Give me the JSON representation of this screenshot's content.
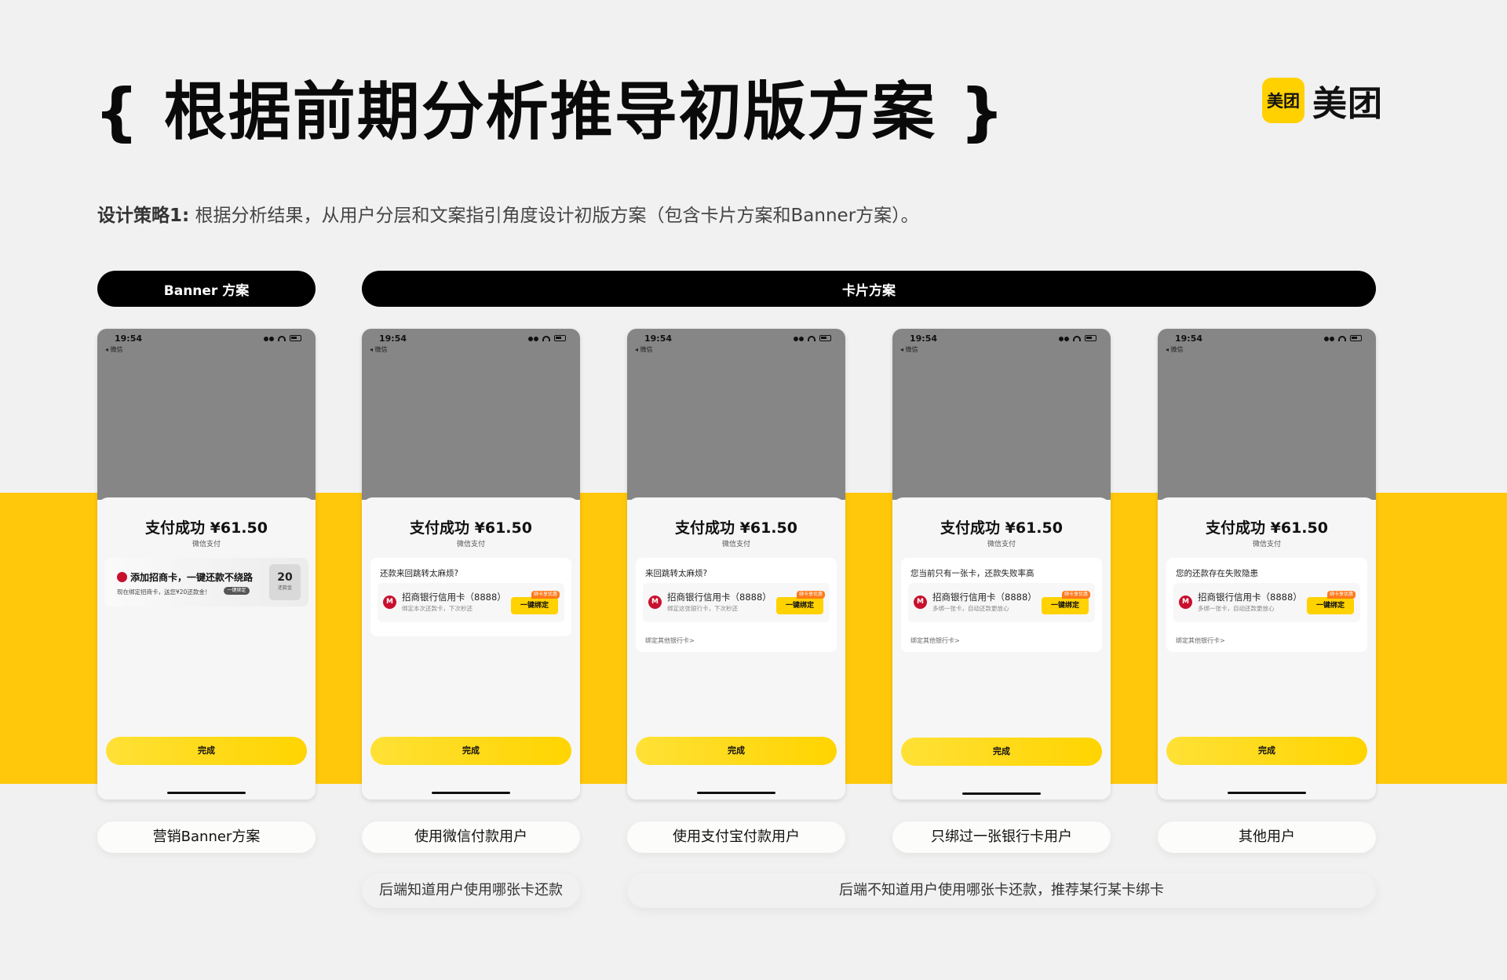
{
  "title": "{ 根据前期分析推导初版方案 }",
  "logo": {
    "badge": "美团",
    "text": "美团",
    "brand_color": "#ffd100"
  },
  "strategy": {
    "label": "设计策略1:",
    "text": " 根据分析结果，从用户分层和文案指引角度设计初版方案（包含卡片方案和Banner方案）。"
  },
  "section_pills": {
    "banner": "Banner 方案",
    "card": "卡片方案"
  },
  "accent_band_color": "#ffc80a",
  "phones": [
    {
      "status_time": "19:54",
      "back_label": "◂ 微信",
      "pay_title": "支付成功 ¥61.50",
      "pay_method": "微信支付",
      "banner": {
        "title": "添加招商卡，一键还款不绕路",
        "sub": "现在绑定招商卡，送您¥20还款金！",
        "chip": "一键绑定",
        "coupon_num": "20",
        "coupon_sub": "还款金"
      },
      "done_label": "完成",
      "user_label": "营销Banner方案"
    },
    {
      "status_time": "19:54",
      "back_label": "◂ 微信",
      "pay_title": "支付成功 ¥61.50",
      "pay_method": "微信支付",
      "card": {
        "question": "还款来回跳转太麻烦?",
        "bank_name": "招商银行信用卡（8888）",
        "bank_desc": "绑定本次还款卡，下次秒还",
        "bind_label": "一键绑定",
        "bind_tag": "绑卡享优惠",
        "other_bank": ""
      },
      "done_label": "完成",
      "user_label": "使用微信付款用户"
    },
    {
      "status_time": "19:54",
      "back_label": "◂ 微信",
      "pay_title": "支付成功 ¥61.50",
      "pay_method": "微信支付",
      "card": {
        "question": "来回跳转太麻烦?",
        "bank_name": "招商银行信用卡（8888）",
        "bank_desc": "绑定这张银行卡，下次秒还",
        "bind_label": "一键绑定",
        "bind_tag": "绑卡享优惠",
        "other_bank": "绑定其他银行卡>"
      },
      "done_label": "完成",
      "user_label": "使用支付宝付款用户"
    },
    {
      "status_time": "19:54",
      "back_label": "◂ 微信",
      "pay_title": "支付成功 ¥61.50",
      "pay_method": "微信支付",
      "card": {
        "question": "您当前只有一张卡，还款失败率高",
        "bank_name": "招商银行信用卡（8888）",
        "bank_desc": "多绑一张卡，自动还款更放心",
        "bind_label": "一键绑定",
        "bind_tag": "绑卡享优惠",
        "other_bank": "绑定其他银行卡>"
      },
      "done_label": "完成",
      "user_label": "只绑过一张银行卡用户"
    },
    {
      "status_time": "19:54",
      "back_label": "◂ 微信",
      "pay_title": "支付成功 ¥61.50",
      "pay_method": "微信支付",
      "card": {
        "question": "您的还款存在失败隐患",
        "bank_name": "招商银行信用卡（8888）",
        "bank_desc": "多绑一张卡，自动还款更放心",
        "bind_label": "一键绑定",
        "bind_tag": "绑卡享优惠",
        "other_bank": "绑定其他银行卡>"
      },
      "done_label": "完成",
      "user_label": "其他用户"
    }
  ],
  "notes": {
    "known": "后端知道用户使用哪张卡还款",
    "unknown": "后端不知道用户使用哪张卡还款，推荐某行某卡绑卡"
  }
}
